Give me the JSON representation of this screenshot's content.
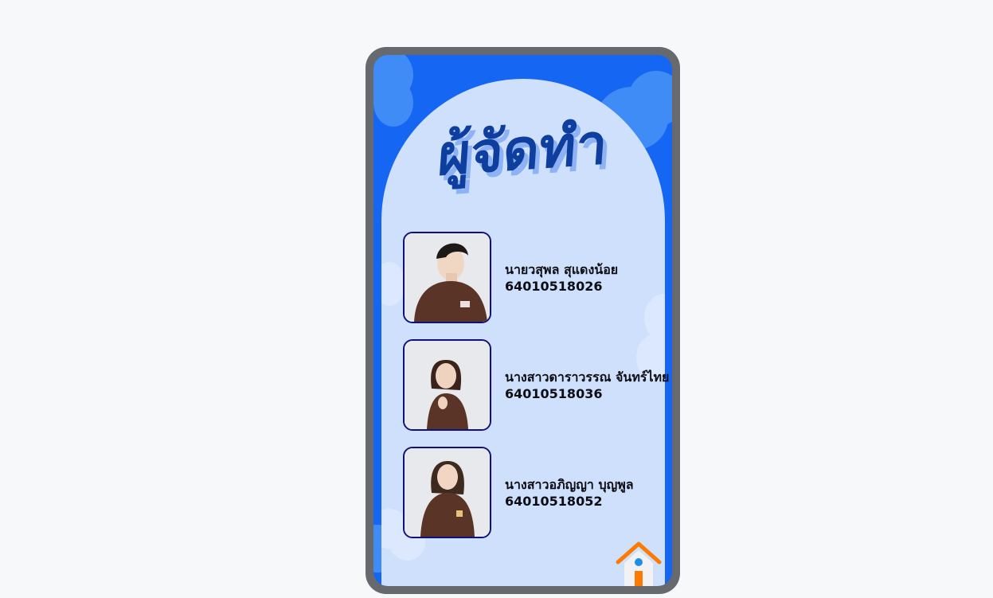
{
  "header": {
    "title": "ผู้จัดทำ"
  },
  "members": [
    {
      "name": "นายวสุพล สุแดงน้อย",
      "student_id": "64010518026"
    },
    {
      "name": "นางสาวดาราวรรณ จันทร์ไทย",
      "student_id": "64010518036"
    },
    {
      "name": "นางสาวอภิญญา บุญพูล",
      "student_id": "64010518052"
    }
  ],
  "navigation": {
    "home_icon": "home-icon"
  },
  "colors": {
    "background": "#f6f8fa",
    "frame": "#666a6e",
    "screen_blue": "#1566f2",
    "arch": "#cfe0fd",
    "title": "#0f3f9e",
    "photo_border": "#10127a",
    "home_roof": "#ff7a00",
    "home_dot": "#1f8fe6"
  }
}
